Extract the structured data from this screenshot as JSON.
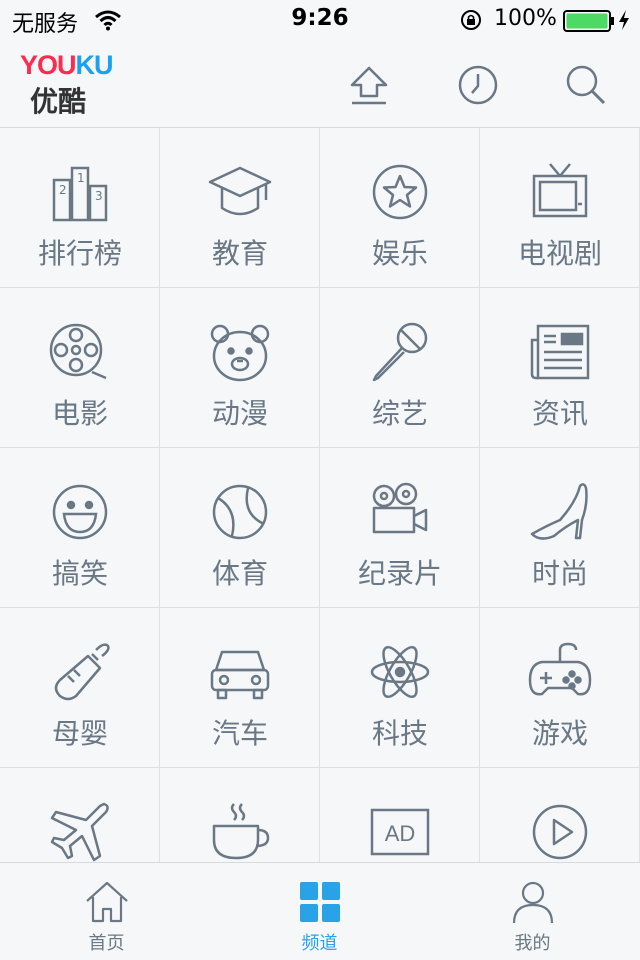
{
  "status_bar": {
    "carrier": "无服务",
    "time": "9:26",
    "battery": "100%"
  },
  "header": {
    "logo_brand_a": "YOU",
    "logo_brand_b": "KU",
    "logo_cn": "优酷"
  },
  "channels": [
    {
      "label": "排行榜",
      "icon": "ranking-icon"
    },
    {
      "label": "教育",
      "icon": "graduation-cap-icon"
    },
    {
      "label": "娱乐",
      "icon": "star-icon"
    },
    {
      "label": "电视剧",
      "icon": "tv-icon"
    },
    {
      "label": "电影",
      "icon": "film-reel-icon"
    },
    {
      "label": "动漫",
      "icon": "bear-icon"
    },
    {
      "label": "综艺",
      "icon": "microphone-icon"
    },
    {
      "label": "资讯",
      "icon": "newspaper-icon"
    },
    {
      "label": "搞笑",
      "icon": "smiley-icon"
    },
    {
      "label": "体育",
      "icon": "ball-icon"
    },
    {
      "label": "纪录片",
      "icon": "video-camera-icon"
    },
    {
      "label": "时尚",
      "icon": "high-heel-icon"
    },
    {
      "label": "母婴",
      "icon": "baby-bottle-icon"
    },
    {
      "label": "汽车",
      "icon": "car-icon"
    },
    {
      "label": "科技",
      "icon": "atom-icon"
    },
    {
      "label": "游戏",
      "icon": "gamepad-icon"
    },
    {
      "label": "",
      "icon": "airplane-icon"
    },
    {
      "label": "",
      "icon": "coffee-cup-icon"
    },
    {
      "label": "",
      "icon": "ad-icon"
    },
    {
      "label": "",
      "icon": "play-circle-icon"
    }
  ],
  "tabs": [
    {
      "label": "首页",
      "icon": "home-icon"
    },
    {
      "label": "频道",
      "icon": "grid-icon"
    },
    {
      "label": "我的",
      "icon": "user-icon"
    }
  ],
  "colors": {
    "icon_gray": "#6a7886",
    "active_blue": "#2aa2e6",
    "logo_red": "#ff2a4f",
    "logo_blue": "#1aa1f0",
    "battery_green": "#4cd964"
  }
}
